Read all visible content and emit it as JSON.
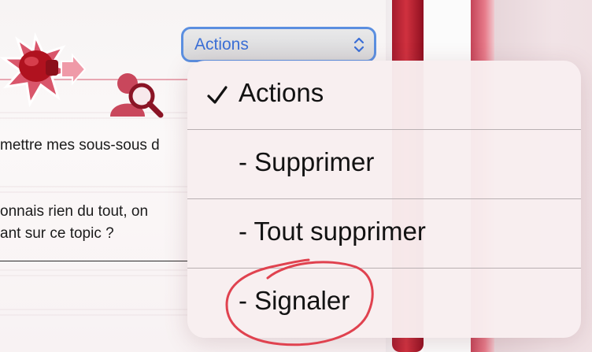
{
  "background": {
    "text_lines": [
      "mettre mes sous-sous d",
      "onnais rien du tout, on",
      "ant sur ce topic ?"
    ]
  },
  "actions_select": {
    "label": "Actions"
  },
  "menu": {
    "items": [
      {
        "label": "Actions",
        "selected": true
      },
      {
        "label": "- Supprimer",
        "selected": false
      },
      {
        "label": "- Tout supprimer",
        "selected": false
      },
      {
        "label": "- Signaler",
        "selected": false
      }
    ]
  },
  "colors": {
    "accent_blue": "#3b6fd6",
    "annotation_red": "#e0424f",
    "brand_red": "#c42a3a"
  },
  "icons": {
    "logo": "boxing-glove-arrow-icon",
    "search_user": "search-user-icon",
    "checkmark": "checkmark-icon",
    "chevron": "chevron-up-down-icon"
  }
}
